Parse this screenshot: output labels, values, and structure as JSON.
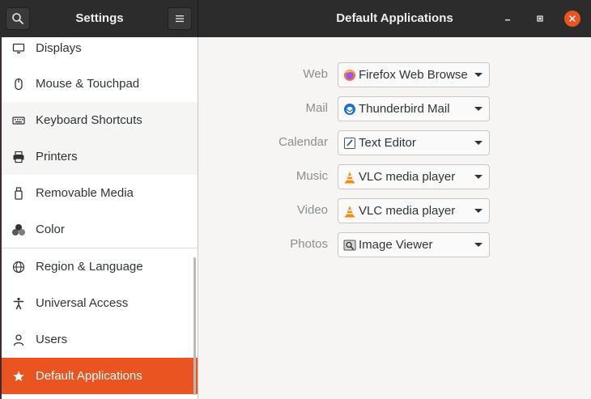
{
  "header": {
    "sidebar_title": "Settings",
    "main_title": "Default Applications",
    "search_icon": "search-icon",
    "menu_icon": "hamburger-menu-icon",
    "accent_color": "#e95420"
  },
  "sidebar": {
    "items": [
      {
        "label": "Displays",
        "icon": "display-icon"
      },
      {
        "label": "Mouse & Touchpad",
        "icon": "mouse-icon"
      },
      {
        "label": "Keyboard Shortcuts",
        "icon": "keyboard-icon"
      },
      {
        "label": "Printers",
        "icon": "printer-icon"
      },
      {
        "label": "Removable Media",
        "icon": "usb-drive-icon"
      },
      {
        "label": "Color",
        "icon": "color-icon"
      },
      {
        "label": "Region & Language",
        "icon": "globe-icon"
      },
      {
        "label": "Universal Access",
        "icon": "accessibility-icon"
      },
      {
        "label": "Users",
        "icon": "user-icon"
      },
      {
        "label": "Default Applications",
        "icon": "star-icon",
        "selected": true
      }
    ]
  },
  "defaults": {
    "rows": [
      {
        "label": "Web",
        "value": "Firefox Web Browser",
        "icon": "firefox-icon"
      },
      {
        "label": "Mail",
        "value": "Thunderbird Mail",
        "icon": "thunderbird-icon"
      },
      {
        "label": "Calendar",
        "value": "Text Editor",
        "icon": "text-editor-icon"
      },
      {
        "label": "Music",
        "value": "VLC media player",
        "icon": "vlc-icon"
      },
      {
        "label": "Video",
        "value": "VLC media player",
        "icon": "vlc-icon"
      },
      {
        "label": "Photos",
        "value": "Image Viewer",
        "icon": "image-viewer-icon"
      }
    ]
  }
}
